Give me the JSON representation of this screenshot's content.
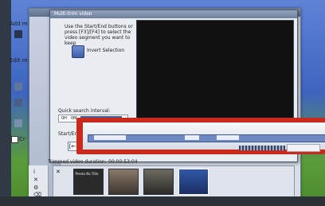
{
  "back_window": {
    "sidebar_texts": [
      "Add m",
      "Edit m"
    ],
    "checkbox_label": "Cr"
  },
  "dialog": {
    "title": "Multi-trim video",
    "instruction": "Use the Start/End buttons or press [F3]/[F4] to select the video segment you want to keep",
    "invert_label": "Invert Selection",
    "quick_search_label": "Quick search interval:",
    "quick_on": "0H",
    "quick_off": "0M",
    "startend_label": "Start/End",
    "start_btn": "[←",
    "end_btn": "→"
  },
  "storyboard": {
    "trimmed_label": "Trimmed video duration:",
    "trimmed_value": "00:00:53:04",
    "first_thumb_text": "Presto No Title"
  },
  "colors": {
    "highlight_frame": "#c92a1c",
    "preview_bg": "#111111"
  }
}
